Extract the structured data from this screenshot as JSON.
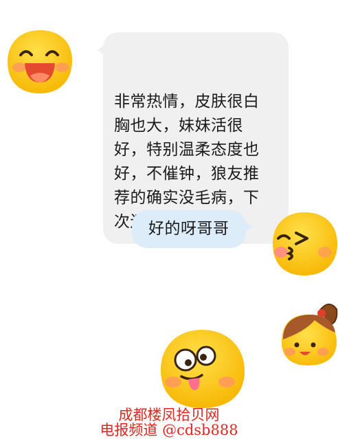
{
  "messages": [
    {
      "side": "left",
      "text": "非常热情，皮肤很白\n胸也大，妹妹活很\n好，特别温柔态度也\n好，不催钟，狼友推\n荐的确实没毛病，下\n次还来回锅妹妹"
    },
    {
      "side": "right",
      "text": "好的呀哥哥"
    }
  ],
  "avatars": {
    "left": "laughing-emoji-avatar",
    "right": "kissing-wink-emoji-avatar"
  },
  "stickers": [
    "ponytail-girl-emoji-sticker",
    "tongue-out-emoji-sticker"
  ],
  "watermark": {
    "line1": "成都楼凤拾贝网",
    "line2": "电报频道 @cdsb888"
  },
  "colors": {
    "incoming_bubble": "#f0f0f0",
    "outgoing_bubble": "#dcecf9",
    "emoji_yellow": "#ffc91c",
    "watermark": "#e0271f"
  }
}
